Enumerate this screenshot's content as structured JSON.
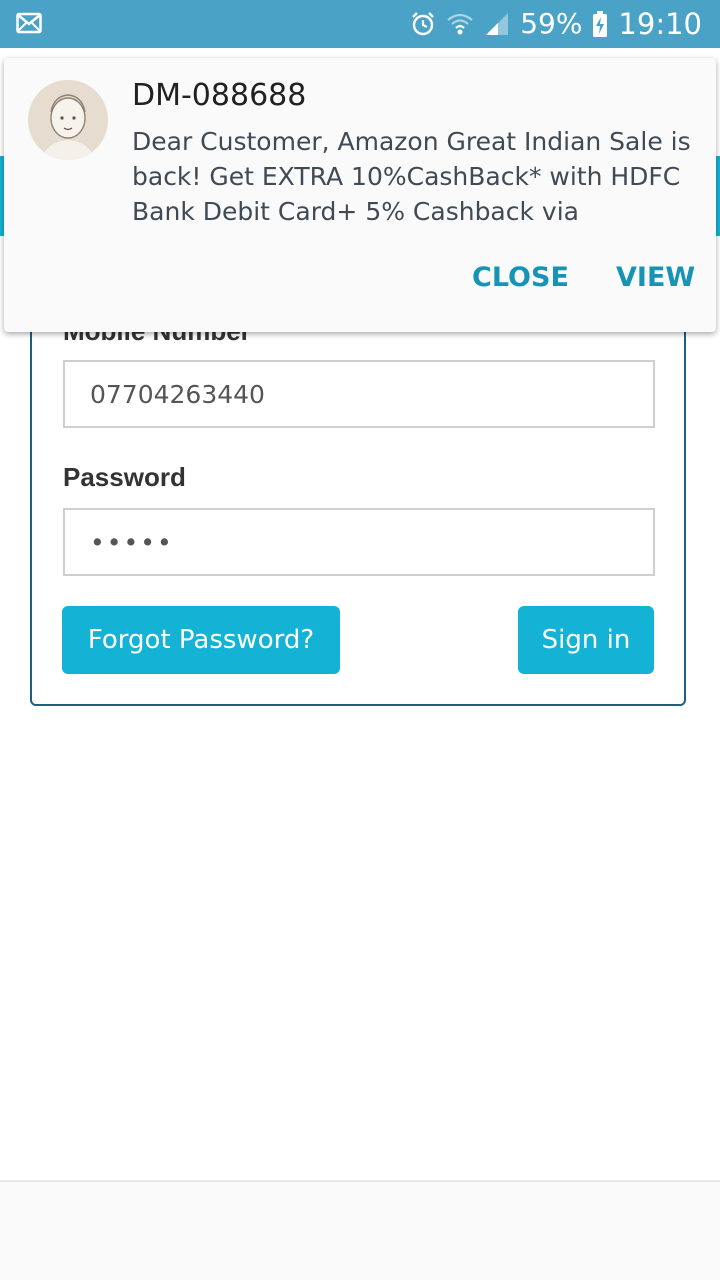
{
  "status_bar": {
    "notification_icon": "mail-icon",
    "alarm_icon": "alarm-icon",
    "wifi_icon": "wifi-icon",
    "signal_icon": "signal-icon",
    "battery_percent": "59%",
    "battery_icon": "battery-charging-icon",
    "time": "19:10",
    "background_color": "#4aa3c7"
  },
  "notification": {
    "avatar_icon": "contact-avatar-icon",
    "sender": "DM-088688",
    "message": "Dear Customer, Amazon Great Indian Sale is back! Get EXTRA 10%CashBack* with HDFC Bank Debit Card+ 5% Cashback via",
    "actions": {
      "close_label": "CLOSE",
      "view_label": "VIEW"
    },
    "action_color": "#1793b5"
  },
  "login_form": {
    "mobile_label": "Mobile Number",
    "mobile_value": "07704263440",
    "password_label": "Password",
    "password_value": "•••••",
    "forgot_button": "Forgot Password?",
    "signin_button": "Sign in",
    "accent_color": "#14b3d6",
    "border_color": "#1f5f7e"
  }
}
